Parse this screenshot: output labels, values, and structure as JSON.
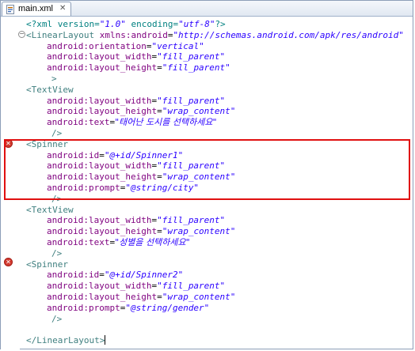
{
  "editor": {
    "tab": {
      "label": "main.xml",
      "close_glyph": "✕",
      "icon": "xml-file-icon"
    },
    "error_marker_glyph": "✕",
    "fold_glyph": "−",
    "lines": [
      [
        [
          "p",
          "<?xml version="
        ],
        [
          "s",
          "\"1.0\""
        ],
        [
          "p",
          " encoding="
        ],
        [
          "s",
          "\"utf-8\""
        ],
        [
          "p",
          "?>"
        ]
      ],
      [
        [
          "t",
          "<LinearLayout "
        ],
        [
          "a",
          "xmlns:android"
        ],
        [
          "eq",
          "="
        ],
        [
          "s",
          "\"http://schemas.android.com/apk/res/android\""
        ]
      ],
      [
        [
          "a",
          "android:orientation"
        ],
        [
          "eq",
          "="
        ],
        [
          "s",
          "\"vertical\""
        ]
      ],
      [
        [
          "a",
          "android:layout_width"
        ],
        [
          "eq",
          "="
        ],
        [
          "s",
          "\"fill_parent\""
        ]
      ],
      [
        [
          "a",
          "android:layout_height"
        ],
        [
          "eq",
          "="
        ],
        [
          "s",
          "\"fill_parent\""
        ]
      ],
      [
        [
          "t",
          ">"
        ]
      ],
      [
        [
          "t",
          "<TextView"
        ]
      ],
      [
        [
          "a",
          "android:layout_width"
        ],
        [
          "eq",
          "="
        ],
        [
          "s",
          "\"fill_parent\""
        ]
      ],
      [
        [
          "a",
          "android:layout_height"
        ],
        [
          "eq",
          "="
        ],
        [
          "s",
          "\"wrap_content\""
        ]
      ],
      [
        [
          "a",
          "android:text"
        ],
        [
          "eq",
          "="
        ],
        [
          "sk",
          "\"태어난 도시를 선택하세요\""
        ]
      ],
      [
        [
          "t",
          "/>"
        ]
      ],
      [
        [
          "t",
          "<Spinner"
        ]
      ],
      [
        [
          "a",
          "android:id"
        ],
        [
          "eq",
          "="
        ],
        [
          "s",
          "\"@+id/Spinner1\""
        ]
      ],
      [
        [
          "a",
          "android:layout_width"
        ],
        [
          "eq",
          "="
        ],
        [
          "s",
          "\"fill_parent\""
        ]
      ],
      [
        [
          "a",
          "android:layout_height"
        ],
        [
          "eq",
          "="
        ],
        [
          "s",
          "\"wrap_content\""
        ]
      ],
      [
        [
          "a",
          "android:prompt"
        ],
        [
          "eq",
          "="
        ],
        [
          "s",
          "\"@string/city\""
        ]
      ],
      [
        [
          "t",
          "/>"
        ]
      ],
      [
        [
          "t",
          "<TextView"
        ]
      ],
      [
        [
          "a",
          "android:layout_width"
        ],
        [
          "eq",
          "="
        ],
        [
          "s",
          "\"fill_parent\""
        ]
      ],
      [
        [
          "a",
          "android:layout_height"
        ],
        [
          "eq",
          "="
        ],
        [
          "s",
          "\"wrap_content\""
        ]
      ],
      [
        [
          "a",
          "android:text"
        ],
        [
          "eq",
          "="
        ],
        [
          "sk",
          "\"성별을 선택하세요\""
        ]
      ],
      [
        [
          "t",
          "/>"
        ]
      ],
      [
        [
          "t",
          "<Spinner"
        ]
      ],
      [
        [
          "a",
          "android:id"
        ],
        [
          "eq",
          "="
        ],
        [
          "s",
          "\"@+id/Spinner2\""
        ]
      ],
      [
        [
          "a",
          "android:layout_width"
        ],
        [
          "eq",
          "="
        ],
        [
          "s",
          "\"fill_parent\""
        ]
      ],
      [
        [
          "a",
          "android:layout_height"
        ],
        [
          "eq",
          "="
        ],
        [
          "s",
          "\"wrap_content\""
        ]
      ],
      [
        [
          "a",
          "android:prompt"
        ],
        [
          "eq",
          "="
        ],
        [
          "s",
          "\"@string/gender\""
        ]
      ],
      [
        [
          "t",
          "/>"
        ]
      ],
      [],
      [
        [
          "t",
          "</LinearLayout>"
        ]
      ]
    ],
    "colors": {
      "processing": "#008080",
      "tag": "#3f7f7f",
      "attribute": "#7f007f",
      "string": "#2a00ff",
      "error": "#d33b30",
      "highlight_box": "#e01010"
    }
  }
}
